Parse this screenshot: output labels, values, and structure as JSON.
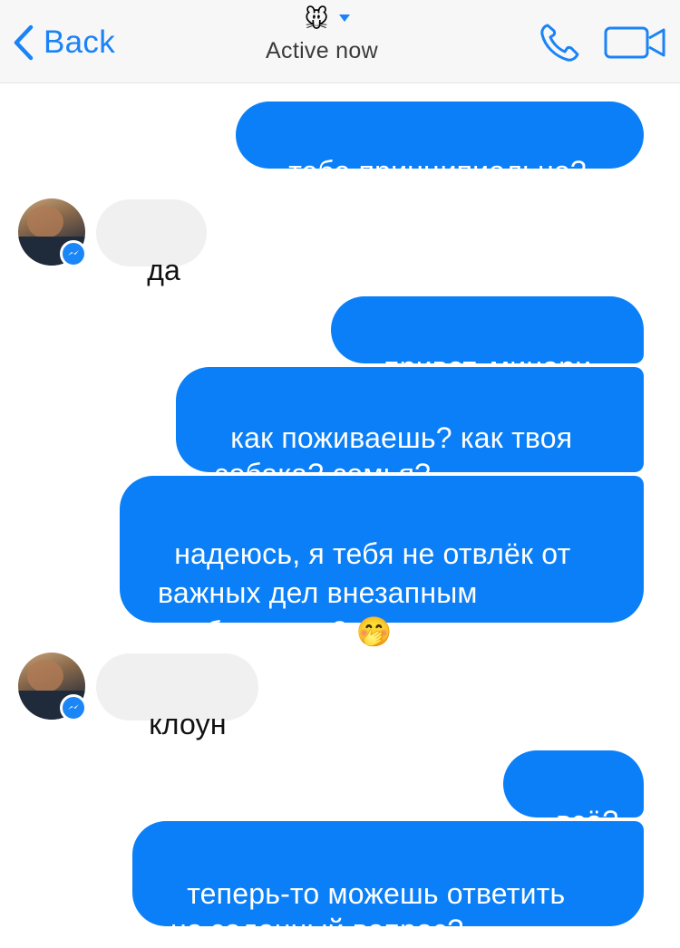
{
  "header": {
    "back_label": "Back",
    "contact_emoji": "🐭",
    "status": "Active now",
    "accent_color": "#1a83f6"
  },
  "icons": {
    "back": "chevron-left-icon",
    "dropdown": "caret-down-icon",
    "call": "phone-icon",
    "video": "video-camera-icon",
    "messenger_badge": "messenger-icon"
  },
  "messages": [
    {
      "side": "out",
      "text": "тебе принципиально?"
    },
    {
      "side": "in",
      "text": "да"
    },
    {
      "side": "out",
      "text": "привет, минари"
    },
    {
      "side": "out",
      "text": "как поживаешь? как твоя\nсобака? семья?"
    },
    {
      "side": "out",
      "text": "надеюсь, я тебя не отвлёк от\nважных дел внезапным\nсообщением? 🤭"
    },
    {
      "side": "in",
      "text": "клоун"
    },
    {
      "side": "out",
      "text": "всё?"
    },
    {
      "side": "out",
      "text": "теперь-то можешь ответить\nна заданный вопрос?"
    }
  ],
  "colors": {
    "outgoing_bubble": "#0a7ff7",
    "incoming_bubble": "#f0f0f0"
  }
}
